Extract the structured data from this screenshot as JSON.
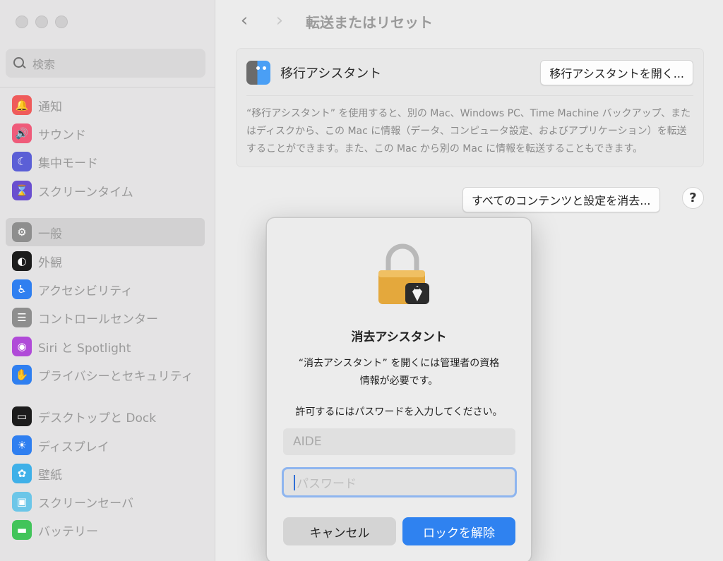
{
  "sidebar": {
    "search_placeholder": "検索",
    "items": [
      {
        "label": "通知",
        "icon": "bell-icon",
        "color": "#ef5b5b",
        "glyph": "🔔"
      },
      {
        "label": "サウンド",
        "icon": "speaker-icon",
        "color": "#ef5b7a",
        "glyph": "🔊"
      },
      {
        "label": "集中モード",
        "icon": "moon-icon",
        "color": "#5b5fd6",
        "glyph": "☾"
      },
      {
        "label": "スクリーンタイム",
        "icon": "hourglass-icon",
        "color": "#6a4fcf",
        "glyph": "⌛"
      },
      {
        "label": "一般",
        "icon": "gear-icon",
        "color": "#8e8e8e",
        "glyph": "⚙"
      },
      {
        "label": "外観",
        "icon": "appearance-icon",
        "color": "#1c1c1c",
        "glyph": "◐"
      },
      {
        "label": "アクセシビリティ",
        "icon": "accessibility-icon",
        "color": "#2f7ff0",
        "glyph": "♿"
      },
      {
        "label": "コントロールセンター",
        "icon": "control-center-icon",
        "color": "#8e8e8e",
        "glyph": "☰"
      },
      {
        "label": "Siri と Spotlight",
        "icon": "siri-icon",
        "color": "#b04ad8",
        "glyph": "◉"
      },
      {
        "label": "プライバシーとセキュリティ",
        "icon": "hand-icon",
        "color": "#2f7ff0",
        "glyph": "✋"
      },
      {
        "label": "デスクトップと Dock",
        "icon": "dock-icon",
        "color": "#1c1c1c",
        "glyph": "▭"
      },
      {
        "label": "ディスプレイ",
        "icon": "display-icon",
        "color": "#2f7ff0",
        "glyph": "☀"
      },
      {
        "label": "壁紙",
        "icon": "wallpaper-icon",
        "color": "#3fb0e8",
        "glyph": "✿"
      },
      {
        "label": "スクリーンセーバ",
        "icon": "screensaver-icon",
        "color": "#6cc6e8",
        "glyph": "▣"
      },
      {
        "label": "バッテリー",
        "icon": "battery-icon",
        "color": "#42c45a",
        "glyph": "▬"
      }
    ]
  },
  "main": {
    "title": "転送またはリセット",
    "back_glyph": "‹",
    "forward_glyph": "›",
    "migration": {
      "title": "移行アシスタント",
      "open_button": "移行アシスタントを開く...",
      "description": "“移行アシスタント” を使用すると、別の Mac、Windows PC、Time Machine バックアップ、またはディスクから、この Mac に情報（データ、コンピュータ設定、およびアプリケーション）を転送することができます。また、この Mac から別の Mac に情報を転送することもできます。"
    },
    "erase_button": "すべてのコンテンツと設定を消去...",
    "help_label": "?"
  },
  "dialog": {
    "title": "消去アシスタント",
    "message_line1": "“消去アシスタント” を開くには管理者の資格",
    "message_line2": "情報が必要です。",
    "prompt": "許可するにはパスワードを入力してください。",
    "username": "AIDE",
    "password_placeholder": "パスワード",
    "cancel_label": "キャンセル",
    "unlock_label": "ロックを解除"
  }
}
